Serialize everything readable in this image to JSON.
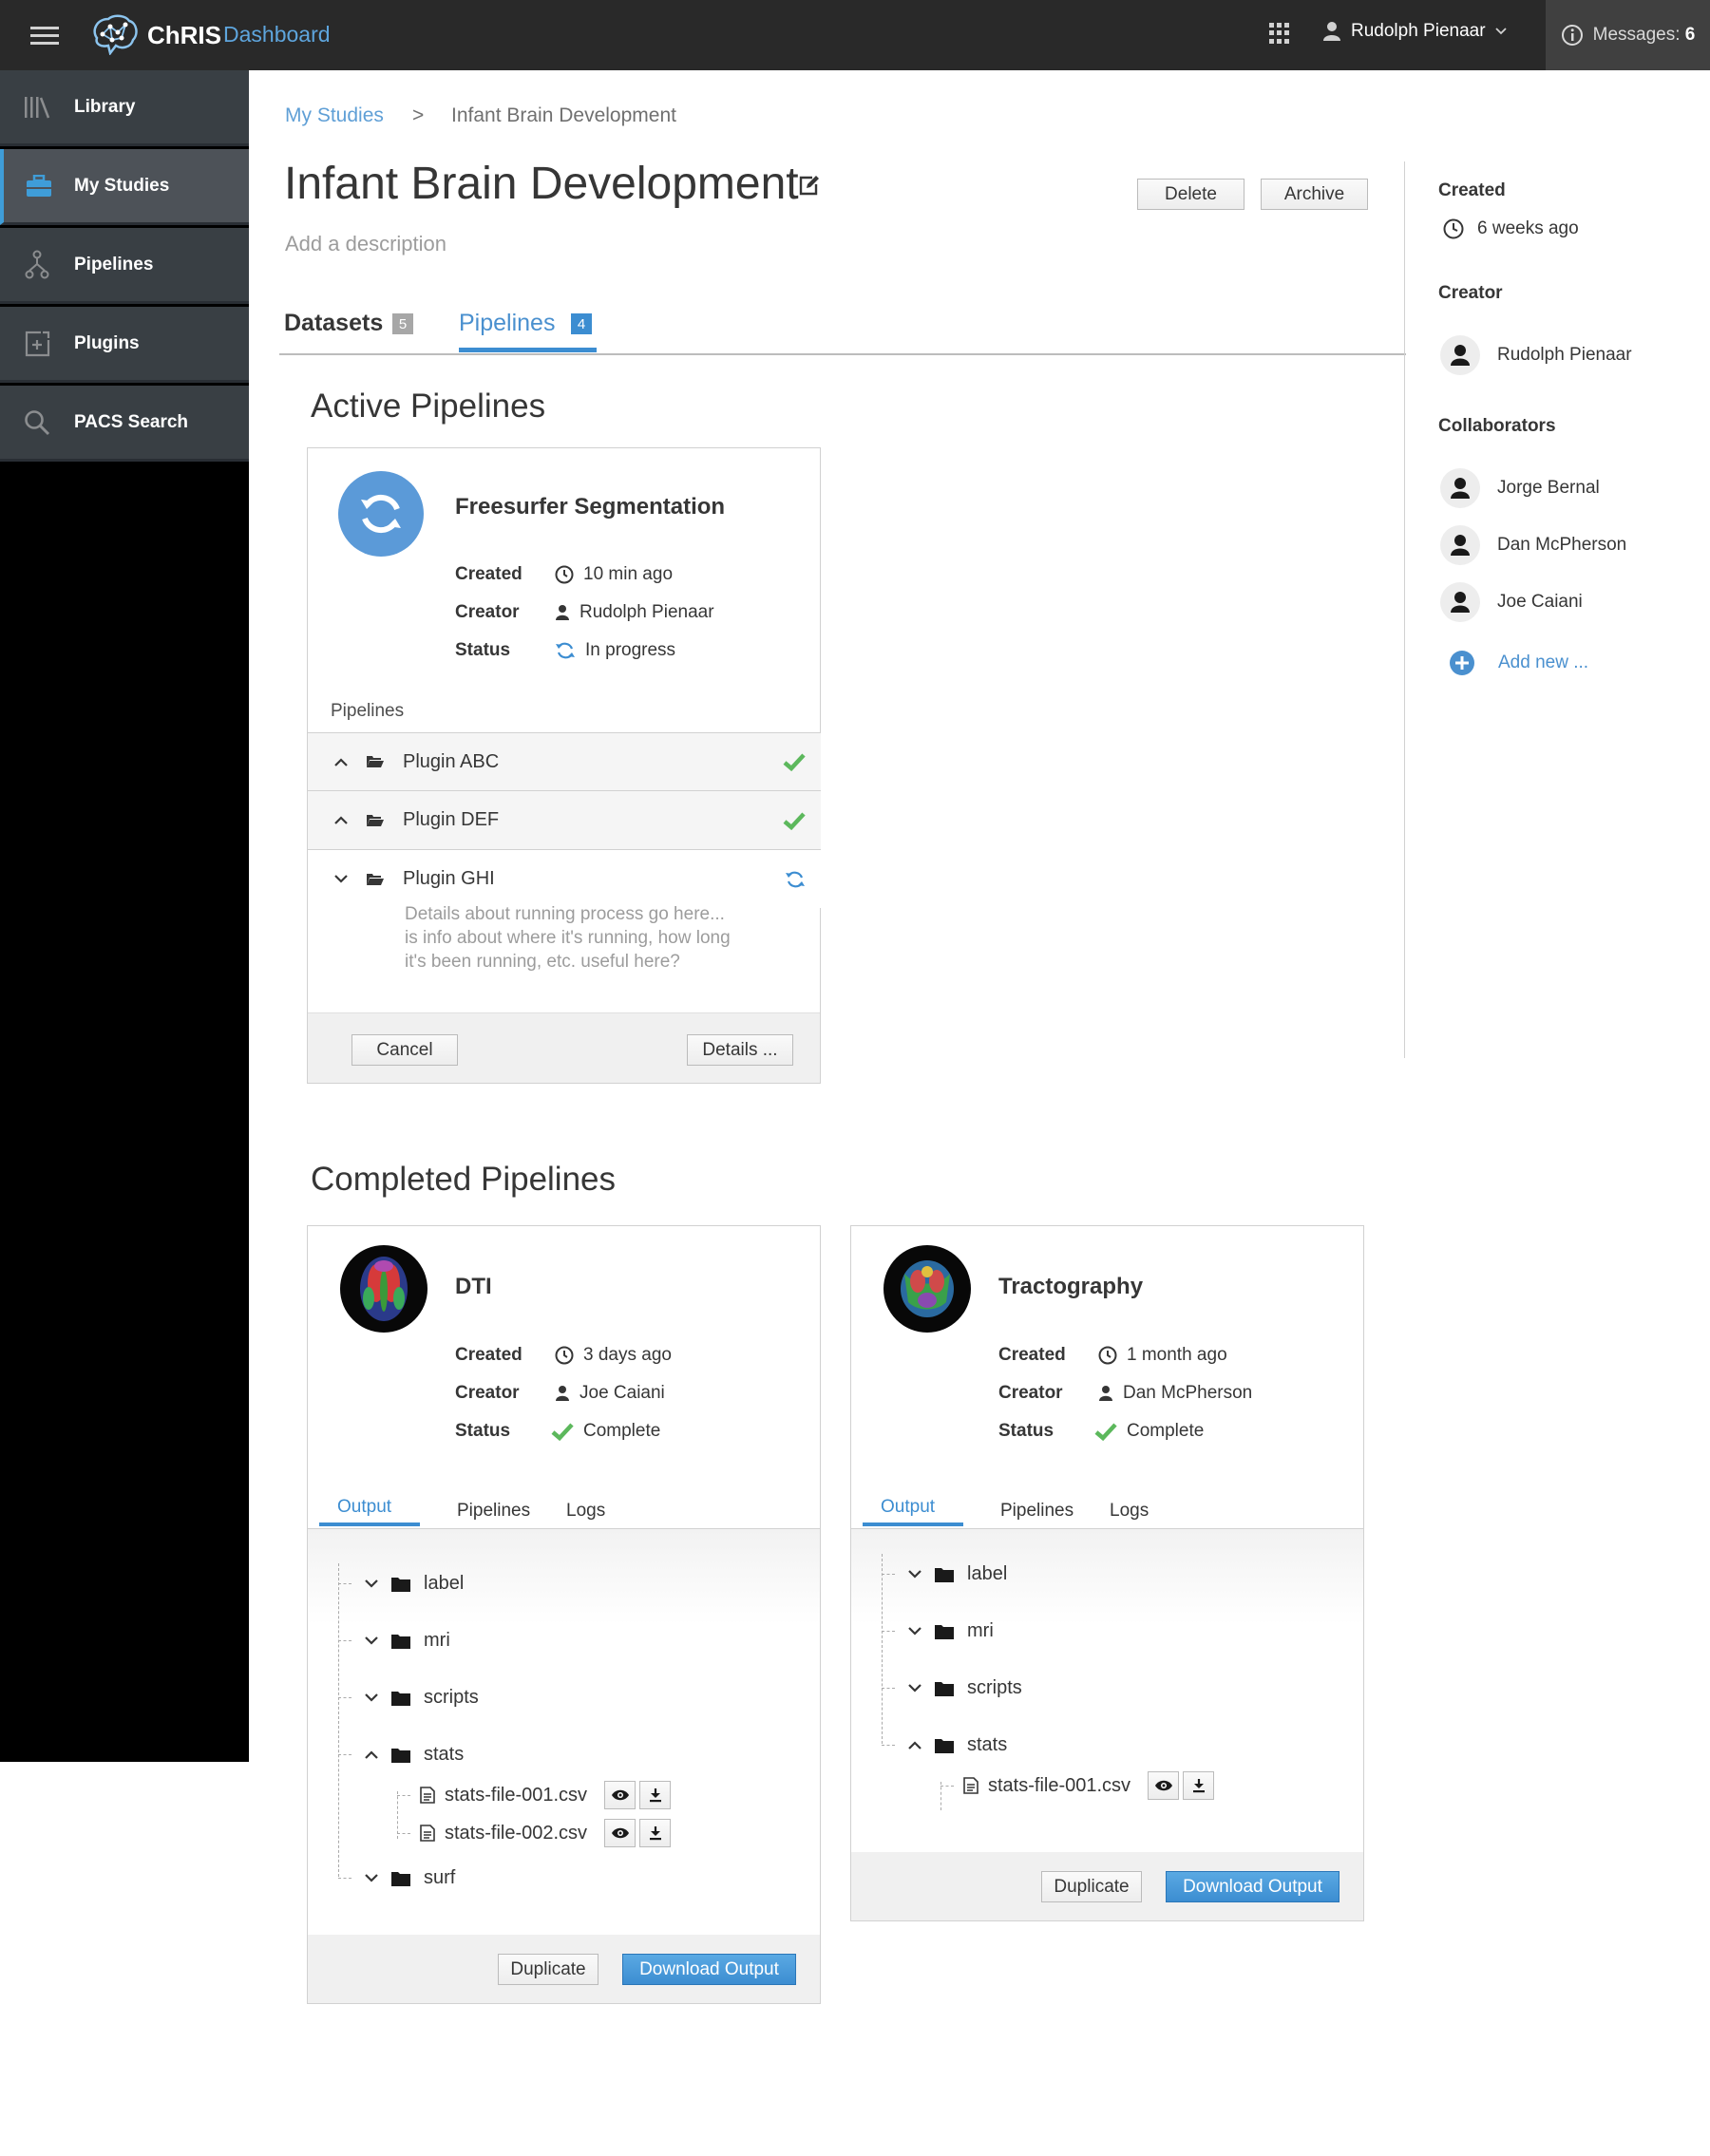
{
  "topbar": {
    "brand": "ChRIS",
    "brand_sub": "Dashboard",
    "user_name": "Rudolph Pienaar",
    "messages_label": "Messages:",
    "messages_count": "6"
  },
  "sidebar": {
    "items": [
      {
        "label": "Library"
      },
      {
        "label": "My Studies"
      },
      {
        "label": "Pipelines"
      },
      {
        "label": "Plugins"
      },
      {
        "label": "PACS Search"
      }
    ],
    "active": "My Studies"
  },
  "breadcrumb": {
    "root": "My Studies",
    "separator": ">",
    "current": "Infant Brain Development"
  },
  "study": {
    "title": "Infant Brain Development",
    "description_placeholder": "Add a description",
    "delete_label": "Delete",
    "archive_label": "Archive"
  },
  "tabs": [
    {
      "label": "Datasets",
      "count": "5"
    },
    {
      "label": "Pipelines",
      "count": "4",
      "active": true
    }
  ],
  "active_section": {
    "title": "Active Pipelines",
    "card": {
      "name": "Freesurfer Segmentation",
      "created_label": "Created",
      "created_value": "10 min ago",
      "creator_label": "Creator",
      "creator_value": "Rudolph Pienaar",
      "status_label": "Status",
      "status_value": "In progress",
      "pipelines_label": "Pipelines",
      "plugins": [
        {
          "name": "Plugin ABC",
          "state": "complete"
        },
        {
          "name": "Plugin DEF",
          "state": "complete"
        },
        {
          "name": "Plugin GHI",
          "state": "running",
          "details": [
            "Details about running process go here...",
            "is info about where it's running, how long",
            "it's been running, etc. useful here?"
          ]
        }
      ],
      "cancel_label": "Cancel",
      "details_label": "Details ..."
    }
  },
  "completed_section": {
    "title": "Completed Pipelines",
    "cards": [
      {
        "name": "DTI",
        "created_label": "Created",
        "created_value": "3 days ago",
        "creator_label": "Creator",
        "creator_value": "Joe Caiani",
        "status_label": "Status",
        "status_value": "Complete",
        "tabs": [
          "Output",
          "Pipelines",
          "Logs"
        ],
        "folders": [
          "label",
          "mri",
          "scripts",
          "stats",
          "surf"
        ],
        "files": [
          "stats-file-001.csv",
          "stats-file-002.csv"
        ],
        "duplicate_label": "Duplicate",
        "download_label": "Download Output"
      },
      {
        "name": "Tractography",
        "created_label": "Created",
        "created_value": "1 month ago",
        "creator_label": "Creator",
        "creator_value": "Dan McPherson",
        "status_label": "Status",
        "status_value": "Complete",
        "tabs": [
          "Output",
          "Pipelines",
          "Logs"
        ],
        "folders": [
          "label",
          "mri",
          "scripts",
          "stats"
        ],
        "files": [
          "stats-file-001.csv"
        ],
        "duplicate_label": "Duplicate",
        "download_label": "Download Output"
      }
    ]
  },
  "details_panel": {
    "created_heading": "Created",
    "created_value": "6 weeks ago",
    "creator_heading": "Creator",
    "creator_name": "Rudolph Pienaar",
    "collaborators_heading": "Collaborators",
    "collaborators": [
      "Jorge Bernal",
      "Dan McPherson",
      "Joe Caiani"
    ],
    "add_new_label": "Add new ..."
  },
  "colors": {
    "accent": "#3c8dd1",
    "success": "#5cb85c",
    "topbar": "#292929",
    "sidebar": "#393f44"
  }
}
